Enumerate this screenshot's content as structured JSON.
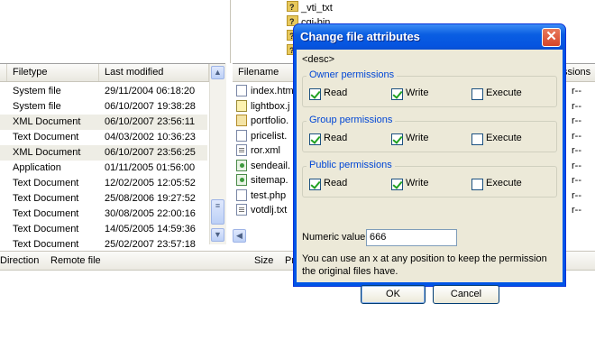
{
  "tree": {
    "items": [
      {
        "label": "_vti_txt"
      },
      {
        "label": "cgi-bin"
      }
    ]
  },
  "local_list": {
    "columns": [
      "Filetype",
      "Last modified"
    ],
    "rows": [
      {
        "type": "System file",
        "modified": "29/11/2004 06:18:20"
      },
      {
        "type": "System file",
        "modified": "06/10/2007 19:38:28"
      },
      {
        "type": "XML Document",
        "modified": "06/10/2007 23:56:11"
      },
      {
        "type": "Text Document",
        "modified": "04/03/2002 10:36:23"
      },
      {
        "type": "XML Document",
        "modified": "06/10/2007 23:56:25"
      },
      {
        "type": "Application",
        "modified": "01/11/2005 01:56:00"
      },
      {
        "type": "Text Document",
        "modified": "12/02/2005 12:05:52"
      },
      {
        "type": "Text Document",
        "modified": "25/08/2006 19:27:52"
      },
      {
        "type": "Text Document",
        "modified": "30/08/2005 22:00:16"
      },
      {
        "type": "Text Document",
        "modified": "14/05/2005 14:59:36"
      },
      {
        "type": "Text Document",
        "modified": "25/02/2007 23:57:18"
      }
    ]
  },
  "remote_list": {
    "columns": [
      "Filename",
      "ssions"
    ],
    "files": [
      {
        "name": "index.htm",
        "icon": "html-file-icon",
        "perm": "r--"
      },
      {
        "name": "lightbox.j",
        "icon": "js-file-icon",
        "perm": "r--"
      },
      {
        "name": "portfolio.",
        "icon": "php-file-icon",
        "perm": "r--"
      },
      {
        "name": "pricelist.",
        "icon": "html-file-icon",
        "perm": "r--"
      },
      {
        "name": "ror.xml",
        "icon": "text-file-icon",
        "perm": "r--"
      },
      {
        "name": "sendeail.",
        "icon": "xml-file-icon",
        "perm": "r--"
      },
      {
        "name": "sitemap.",
        "icon": "xml-file-icon",
        "perm": "r--"
      },
      {
        "name": "test.php",
        "icon": "html-file-icon",
        "perm": "r--"
      },
      {
        "name": "votdlj.txt",
        "icon": "text-file-icon",
        "perm": "r--"
      }
    ]
  },
  "status_bar": {
    "direction": "Direction",
    "remote_file": "Remote file",
    "size": "Size",
    "priority": "Pr"
  },
  "dialog": {
    "title": "Change file attributes",
    "desc": "<desc>",
    "groups": [
      {
        "label": "Owner permissions",
        "read": true,
        "write": true,
        "execute": false
      },
      {
        "label": "Group permissions",
        "read": true,
        "write": true,
        "execute": false
      },
      {
        "label": "Public permissions",
        "read": true,
        "write": true,
        "execute": false
      }
    ],
    "read_label": "Read",
    "write_label": "Write",
    "execute_label": "Execute",
    "numeric_label": "Numeric value:",
    "numeric_value": "666",
    "hint": "You can use an x at any position to keep the permission the original files have.",
    "ok_label": "OK",
    "cancel_label": "Cancel",
    "close_glyph": "✕"
  },
  "colors": {
    "titlebar": "#0a5ee2",
    "group_label": "#0046d5",
    "dialog_face": "#ece9d8"
  }
}
